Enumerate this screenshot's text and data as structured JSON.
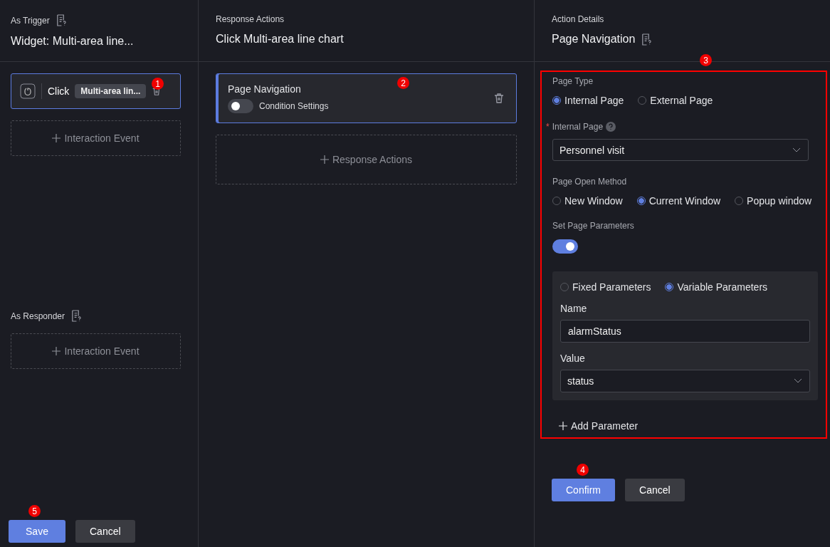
{
  "trigger_panel": {
    "heading": "As Trigger",
    "title": "Widget: Multi-area line...",
    "events": [
      {
        "action": "Click",
        "target": "Multi-area lin...",
        "selected": true,
        "callout": "1"
      }
    ],
    "add_label": "Interaction Event"
  },
  "responder_section": {
    "heading": "As Responder",
    "add_label": "Interaction Event"
  },
  "left_buttons": [
    {
      "label": "Save",
      "kind": "primary",
      "callout": "5"
    },
    {
      "label": "Cancel",
      "kind": "secondary"
    }
  ],
  "response_panel": {
    "heading": "Response Actions",
    "title": "Click Multi-area line chart",
    "actions": [
      {
        "name": "Page Navigation",
        "toggle_label": "Condition Settings",
        "on": false,
        "selected": true,
        "callout": "2"
      }
    ],
    "add_label": "Response Actions"
  },
  "details_panel": {
    "heading": "Action Details",
    "title": "Page Navigation",
    "callout": "3",
    "highlighted": true,
    "page_type": {
      "label": "Page Type",
      "options": [
        {
          "label": "Internal Page",
          "selected": true
        },
        {
          "label": "External Page",
          "selected": false
        }
      ]
    },
    "internal_page": {
      "label": "Internal Page",
      "required_mark": "*",
      "value": "Personnel visit"
    },
    "open_method": {
      "label": "Page Open Method",
      "options": [
        {
          "label": "New Window",
          "selected": false
        },
        {
          "label": "Current Window",
          "selected": true
        },
        {
          "label": "Popup window",
          "selected": false
        }
      ]
    },
    "set_params": {
      "label": "Set Page Parameters",
      "on": true
    },
    "params": {
      "options": [
        {
          "label": "Fixed Parameters",
          "selected": false
        },
        {
          "label": "Variable Parameters",
          "selected": true
        }
      ],
      "name_label": "Name",
      "name_value": "alarmStatus",
      "value_label": "Value",
      "value_value": "status"
    },
    "add_param": "Add Parameter",
    "buttons": [
      {
        "label": "Confirm",
        "kind": "primary",
        "callout": "4"
      },
      {
        "label": "Cancel",
        "kind": "secondary"
      }
    ]
  }
}
